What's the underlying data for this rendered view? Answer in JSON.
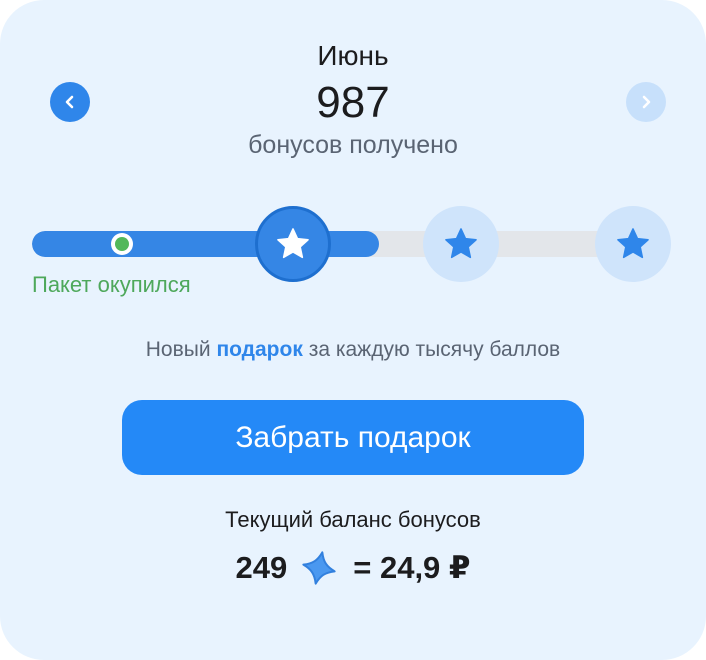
{
  "header": {
    "month": "Июнь",
    "bonus_amount": "987",
    "bonus_caption": "бонусов получено",
    "prev_icon": "chevron-left-icon",
    "next_icon": "chevron-right-icon"
  },
  "progress": {
    "fill_fraction": 0.55,
    "payback_label": "Пакет окупился",
    "milestones": [
      {
        "icon": "star-icon",
        "reached": true
      },
      {
        "icon": "star-icon",
        "reached": false
      },
      {
        "icon": "star-icon",
        "reached": false
      }
    ]
  },
  "gift_info": {
    "prefix": "Новый ",
    "highlight": "подарок",
    "suffix": " за каждую тысячу баллов"
  },
  "claim_button": {
    "label": "Забрать подарок"
  },
  "balance": {
    "title": "Текущий баланс бонусов",
    "points": "249",
    "icon": "bonus-star-icon",
    "equals_value": "= 24,9 ₽"
  },
  "colors": {
    "accent": "#2f86ea",
    "button": "#2489f7",
    "success": "#52b85a",
    "card_bg": "#e8f3fe"
  }
}
